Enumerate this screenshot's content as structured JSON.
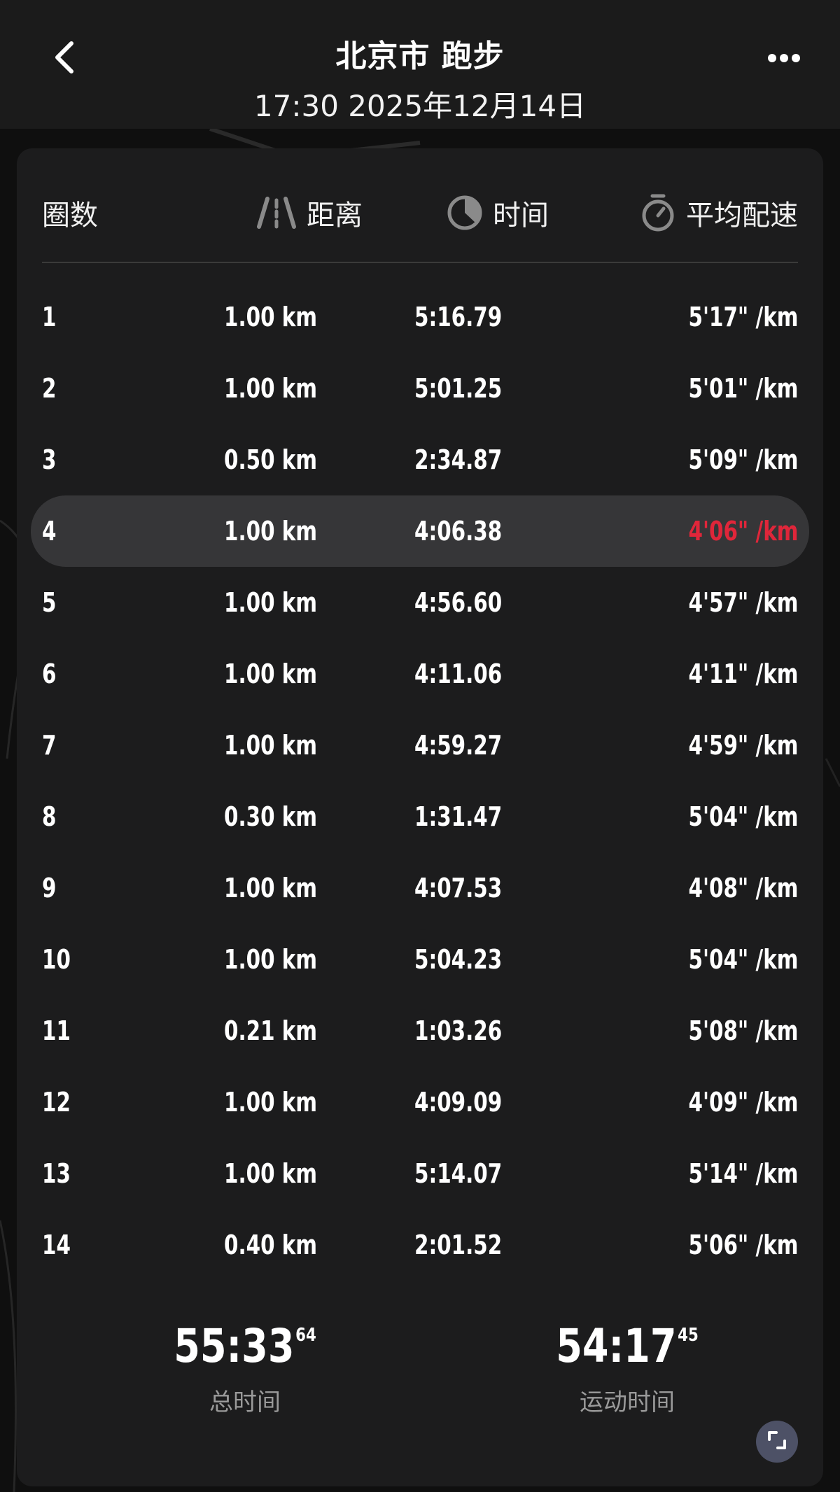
{
  "header": {
    "title": "北京市 跑步",
    "subtitle": "17:30 2025年12月14日",
    "back_icon": "chevron-left-icon",
    "more_icon": "more-horizontal-icon"
  },
  "table": {
    "headers": {
      "lap": "圈数",
      "distance": "距离",
      "time": "时间",
      "pace": "平均配速"
    },
    "rows": [
      {
        "lap": "1",
        "distance": "1.00 km",
        "time": "5:16.79",
        "pace": "5'17\" /km"
      },
      {
        "lap": "2",
        "distance": "1.00 km",
        "time": "5:01.25",
        "pace": "5'01\" /km"
      },
      {
        "lap": "3",
        "distance": "0.50 km",
        "time": "2:34.87",
        "pace": "5'09\" /km"
      },
      {
        "lap": "4",
        "distance": "1.00 km",
        "time": "4:06.38",
        "pace": "4'06\" /km"
      },
      {
        "lap": "5",
        "distance": "1.00 km",
        "time": "4:56.60",
        "pace": "4'57\" /km"
      },
      {
        "lap": "6",
        "distance": "1.00 km",
        "time": "4:11.06",
        "pace": "4'11\" /km"
      },
      {
        "lap": "7",
        "distance": "1.00 km",
        "time": "4:59.27",
        "pace": "4'59\" /km"
      },
      {
        "lap": "8",
        "distance": "0.30 km",
        "time": "1:31.47",
        "pace": "5'04\" /km"
      },
      {
        "lap": "9",
        "distance": "1.00 km",
        "time": "4:07.53",
        "pace": "4'08\" /km"
      },
      {
        "lap": "10",
        "distance": "1.00 km",
        "time": "5:04.23",
        "pace": "5'04\" /km"
      },
      {
        "lap": "11",
        "distance": "0.21 km",
        "time": "1:03.26",
        "pace": "5'08\" /km"
      },
      {
        "lap": "12",
        "distance": "1.00 km",
        "time": "4:09.09",
        "pace": "4'09\" /km"
      },
      {
        "lap": "13",
        "distance": "1.00 km",
        "time": "5:14.07",
        "pace": "5'14\" /km"
      },
      {
        "lap": "14",
        "distance": "0.40 km",
        "time": "2:01.52",
        "pace": "5'06\" /km"
      }
    ],
    "highlight_color": "#e0263a"
  },
  "totals": {
    "total_time": {
      "main": "55:33",
      "fraction": "64",
      "label": "总时间"
    },
    "moving_time": {
      "main": "54:17",
      "fraction": "45",
      "label": "运动时间"
    }
  },
  "expand_icon": "expand-icon"
}
